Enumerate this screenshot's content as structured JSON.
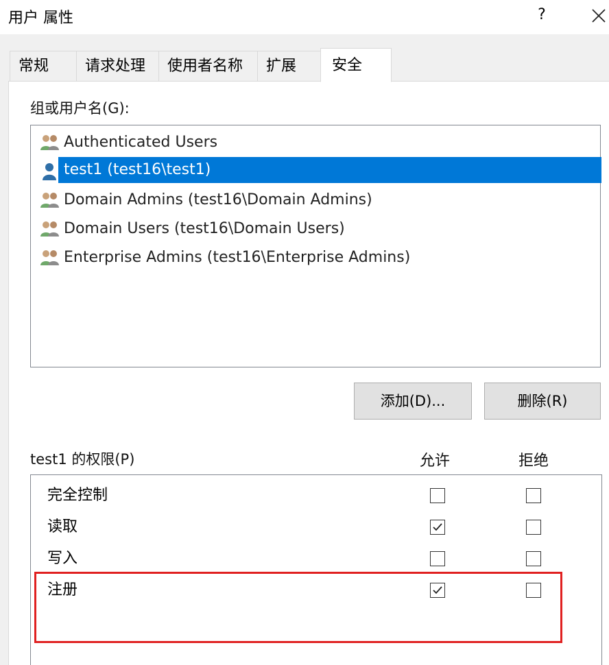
{
  "window": {
    "title": "用户 属性",
    "help_label": "?"
  },
  "tabs": [
    {
      "label": "常规"
    },
    {
      "label": "请求处理"
    },
    {
      "label": "使用者名称"
    },
    {
      "label": "扩展"
    },
    {
      "label": "安全"
    }
  ],
  "security": {
    "group_label": "组或用户名(G):",
    "principals": [
      {
        "name": "Authenticated Users",
        "icon": "group-icon"
      },
      {
        "name": "test1 (test16\\test1)",
        "icon": "user-icon",
        "selected": true
      },
      {
        "name": "Domain Admins (test16\\Domain Admins)",
        "icon": "group-icon"
      },
      {
        "name": "Domain Users (test16\\Domain Users)",
        "icon": "group-icon"
      },
      {
        "name": "Enterprise Admins (test16\\Enterprise Admins)",
        "icon": "group-icon"
      }
    ],
    "add_button": "添加(D)...",
    "remove_button": "删除(R)",
    "permissions_label": "test1 的权限(P)",
    "allow_header": "允许",
    "deny_header": "拒绝",
    "permissions": [
      {
        "name": "完全控制",
        "allow": false,
        "deny": false
      },
      {
        "name": "读取",
        "allow": true,
        "deny": false
      },
      {
        "name": "写入",
        "allow": false,
        "deny": false
      },
      {
        "name": "注册",
        "allow": true,
        "deny": false
      }
    ]
  },
  "colors": {
    "selection": "#0078d7",
    "highlight_border": "#e02020"
  }
}
